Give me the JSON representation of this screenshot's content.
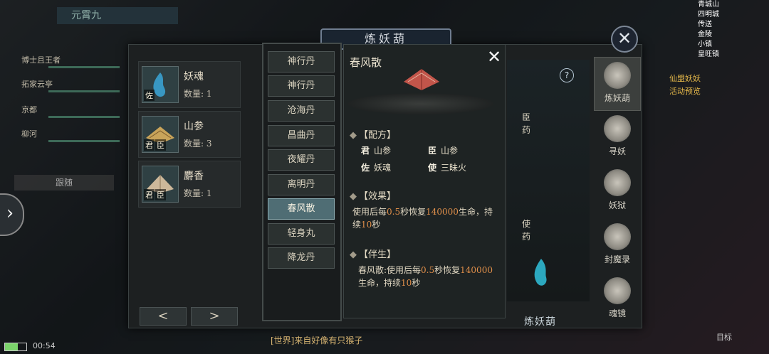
{
  "background": {
    "player_name": "元霄九",
    "party": [
      "博士且王者",
      "拓家云亭",
      "京都",
      "柳河"
    ],
    "follow_label": "跟随",
    "time": "00:54",
    "chat_text": "[世界]来自好像有只猴子",
    "target_label": "目标",
    "top_right_list": [
      "青城山",
      "四明城",
      "传送",
      "金陵",
      "小镇",
      "皇旺镇"
    ],
    "right_hud_lines": [
      "仙盟妖妖",
      "活动预览"
    ]
  },
  "panel": {
    "title": "炼妖葫",
    "close_label": "✕"
  },
  "inventory": [
    {
      "name": "妖魂",
      "qty_label": "数量: 1",
      "tags": [
        "佐"
      ],
      "color": "#3aa7d8"
    },
    {
      "name": "山参",
      "qty_label": "数量: 3",
      "tags": [
        "君",
        "臣"
      ],
      "color": "#c9a45a"
    },
    {
      "name": "麝香",
      "qty_label": "数量: 1",
      "tags": [
        "君",
        "臣"
      ],
      "color": "#cdb89a"
    }
  ],
  "pager": {
    "prev": "<",
    "next": ">"
  },
  "recipes": [
    "神行丹",
    "神行丹",
    "沧海丹",
    "昌曲丹",
    "夜耀丹",
    "离明丹",
    "春风散",
    "轻身丸",
    "降龙丹"
  ],
  "active_recipe_index": 6,
  "detail": {
    "title": "春风散",
    "close": "✕",
    "formula_head": "【配方】",
    "formula": [
      {
        "role": "君",
        "item": "山参"
      },
      {
        "role": "臣",
        "item": "山参"
      },
      {
        "role": "佐",
        "item": "妖魂"
      },
      {
        "role": "使",
        "item": "三昧火"
      }
    ],
    "effect_head": "【效果】",
    "effect": {
      "pre": "使用后每",
      "n1": "0.5",
      "mid": "秒恢复",
      "n2": "140000",
      "post": "生命，持续",
      "n3": "10",
      "end": "秒"
    },
    "companion_head": "【伴生】",
    "companion": {
      "pre": "春风散:使用后每",
      "n1": "0.5",
      "mid": "秒恢复",
      "n2": "140000",
      "post": "生命，持续",
      "n3": "10",
      "end": "秒"
    }
  },
  "preview": {
    "help": "?",
    "slot_chen": "臣药",
    "slot_shi": "使药",
    "refine_label": "炼妖葫"
  },
  "tabs": [
    {
      "label": "炼妖葫",
      "icon": "gourd-icon"
    },
    {
      "label": "寻妖",
      "icon": "swirl-icon"
    },
    {
      "label": "妖狱",
      "icon": "tower-icon"
    },
    {
      "label": "封魔录",
      "icon": "mask-icon"
    },
    {
      "label": "魂镜",
      "icon": "fox-icon"
    }
  ],
  "active_tab_index": 0
}
